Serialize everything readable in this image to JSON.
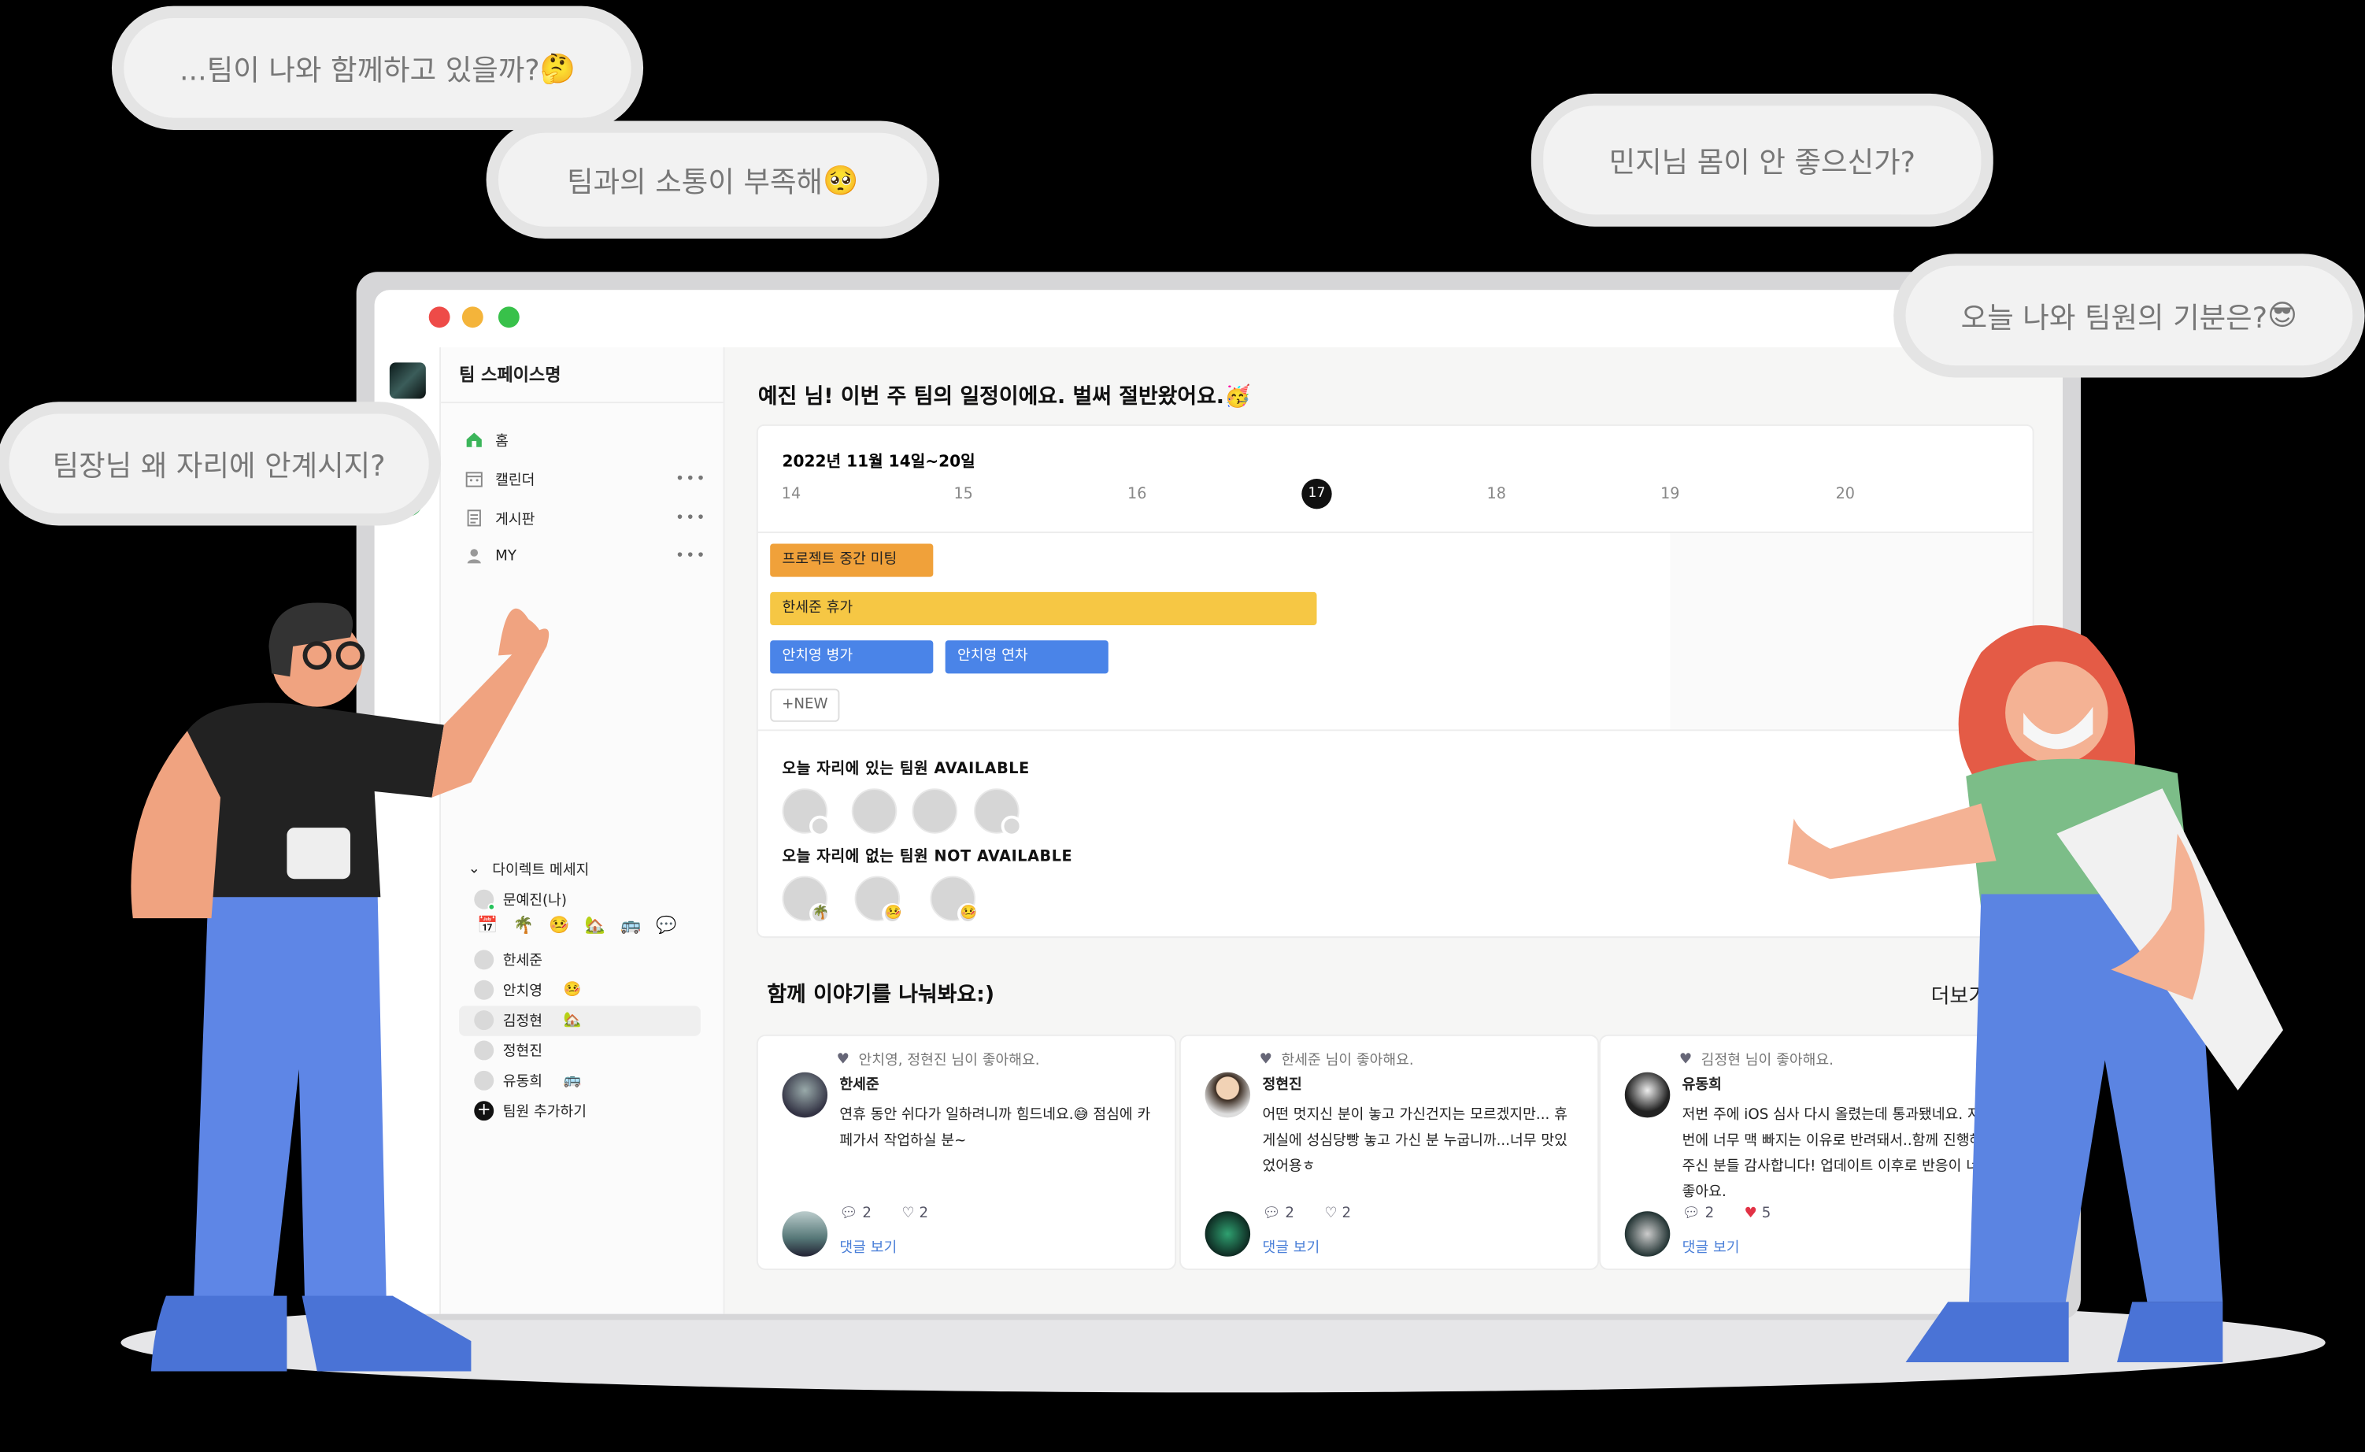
{
  "bubbles": [
    {
      "text": "...팀이 나와 함께하고 있을까?",
      "emoji": "🤔"
    },
    {
      "text": "팀과의 소통이 부족해",
      "emoji": "🥺"
    },
    {
      "text": "민지님 몸이 안 좋으신가?",
      "emoji": ""
    },
    {
      "text": "오늘 나와 팀원의 기분은?",
      "emoji": "😎"
    },
    {
      "text": "팀장님 왜 자리에 안계시지?",
      "emoji": ""
    }
  ],
  "sidebar": {
    "space_name": "팀 스페이스명",
    "nav": [
      {
        "label": "홈",
        "icon": "home-icon"
      },
      {
        "label": "캘린더",
        "icon": "calendar-icon",
        "more": "•••"
      },
      {
        "label": "게시판",
        "icon": "board-icon",
        "more": "•••"
      },
      {
        "label": "MY",
        "icon": "user-icon",
        "more": "•••"
      }
    ],
    "dm_header": "다이렉트 메세지",
    "status_icons": [
      "📅",
      "🌴",
      "🤒",
      "🏡",
      "🚌",
      "💬"
    ],
    "members": [
      {
        "name": "문예진(나)",
        "emoji": ""
      },
      {
        "name": "한세준",
        "emoji": ""
      },
      {
        "name": "안치영",
        "emoji": "🤒"
      },
      {
        "name": "김정현",
        "emoji": "🏡"
      },
      {
        "name": "정현진",
        "emoji": ""
      },
      {
        "name": "유동희",
        "emoji": "🚌"
      }
    ],
    "add_member": "팀원 추가하기"
  },
  "main": {
    "greeting": "예진 님! 이번 주 팀의 일정이에요. 벌써 절반왔어요.🥳",
    "week_title": "2022년 11월 14일~20일",
    "days": [
      "14",
      "15",
      "16",
      "17",
      "18",
      "19",
      "20"
    ],
    "today": "17",
    "events": [
      {
        "label": "프로젝트 중간 미팅",
        "color": "#f0a13a"
      },
      {
        "label": "한세준 휴가",
        "color": "#f6c744"
      },
      {
        "label": "안치영 병가",
        "color": "#4a84e8"
      },
      {
        "label": "안치영 연차",
        "color": "#4a84e8"
      }
    ],
    "new_button": "+NEW",
    "available_label": "오늘 자리에 있는 팀원 AVAILABLE",
    "not_available_label": "오늘 자리에 없는 팀원 NOT AVAILABLE",
    "not_available_emojis": [
      "🌴",
      "🤒",
      "🤒"
    ],
    "stories_title": "함께 이야기를 나눠봐요:)",
    "more": "더보기",
    "posts": [
      {
        "liked": "안치영, 정현진 님이 좋아해요.",
        "author": "한세준",
        "body": "연휴 동안 쉬다가 일하려니까 힘드네요.😅 점심에 카페가서 작업하실 분~",
        "comments": "2",
        "likes": "2",
        "view": "댓글 보기",
        "liked_heart": false
      },
      {
        "liked": "한세준 님이 좋아해요.",
        "author": "정현진",
        "body": "어떤 멋지신 분이 놓고 가신건지는 모르겠지만... 휴게실에 성심당빵 놓고 가신 분 누굽니까...너무 맛있었어용ㅎ",
        "comments": "2",
        "likes": "2",
        "view": "댓글 보기",
        "liked_heart": false
      },
      {
        "liked": "김정현 님이 좋아해요.",
        "author": "유동희",
        "body": "저번 주에 iOS 심사 다시 올렸는데 통과됐네요. 저번에 너무 맥 빠지는 이유로 반려돼서..함께 진행해주신 분들 감사합니다! 업데이트 이후로 반응이 너무 좋아요.",
        "comments": "2",
        "likes": "5",
        "view": "댓글 보기",
        "liked_heart": true
      }
    ]
  },
  "colors": {
    "accent_blue": "#4a84e8",
    "orange": "#f0a13a",
    "yellow": "#f6c744",
    "green_online": "#25c25a",
    "link": "#4a7fd8"
  },
  "floating_emojis": [
    "😭",
    "😍"
  ]
}
